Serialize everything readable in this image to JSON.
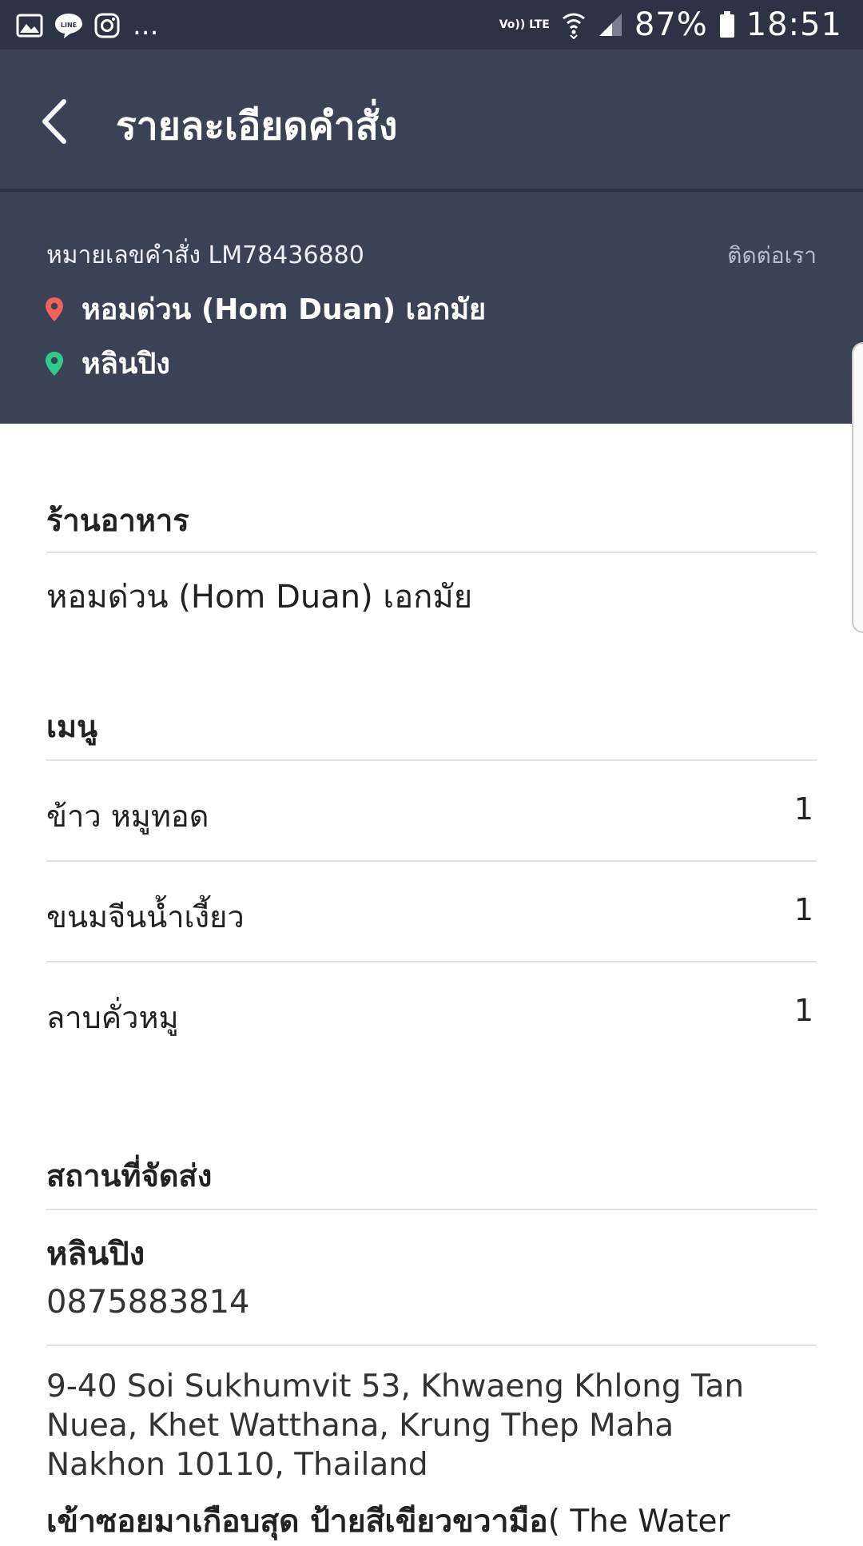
{
  "status_bar": {
    "icons_left": [
      "gallery-icon",
      "line-icon",
      "instagram-icon"
    ],
    "more": "...",
    "network": "Vo)) LTE",
    "battery": "87%",
    "time": "18:51"
  },
  "app_bar": {
    "title": "รายละเอียดคำสั่ง"
  },
  "order": {
    "number_label": "หมายเลขคำสั่ง LM78436880",
    "contact_label": "ติดต่อเรา",
    "pickup": "หอมด่วน (Hom Duan) เอกมัย",
    "dropoff": "หลินปิง"
  },
  "restaurant_section": {
    "heading": "ร้านอาหาร",
    "name": "หอมด่วน (Hom Duan) เอกมัย"
  },
  "menu_section": {
    "heading": "เมนู",
    "items": [
      {
        "name": "ข้าว หมูทอด",
        "qty": "1"
      },
      {
        "name": "ขนมจีนน้ำเงี้ยว",
        "qty": "1"
      },
      {
        "name": "ลาบคั่วหมู",
        "qty": "1"
      }
    ]
  },
  "delivery_section": {
    "heading": "สถานที่จัดส่ง",
    "recipient_name": "หลินปิง",
    "phone": "0875883814",
    "address": "9-40 Soi Sukhumvit 53, Khwaeng Khlong Tan Nuea, Khet Watthana, Krung Thep Maha Nakhon 10110, Thailand",
    "note_bold": "เข้าซอยมาเกือบสุด ป้ายสีเขียวขวามือ",
    "note_rest": "( The Water"
  },
  "colors": {
    "header_bg": "#3a4256",
    "status_bg": "#2d3344",
    "pickup_pin": "#f0625a",
    "dropoff_pin": "#2ecc8a"
  }
}
